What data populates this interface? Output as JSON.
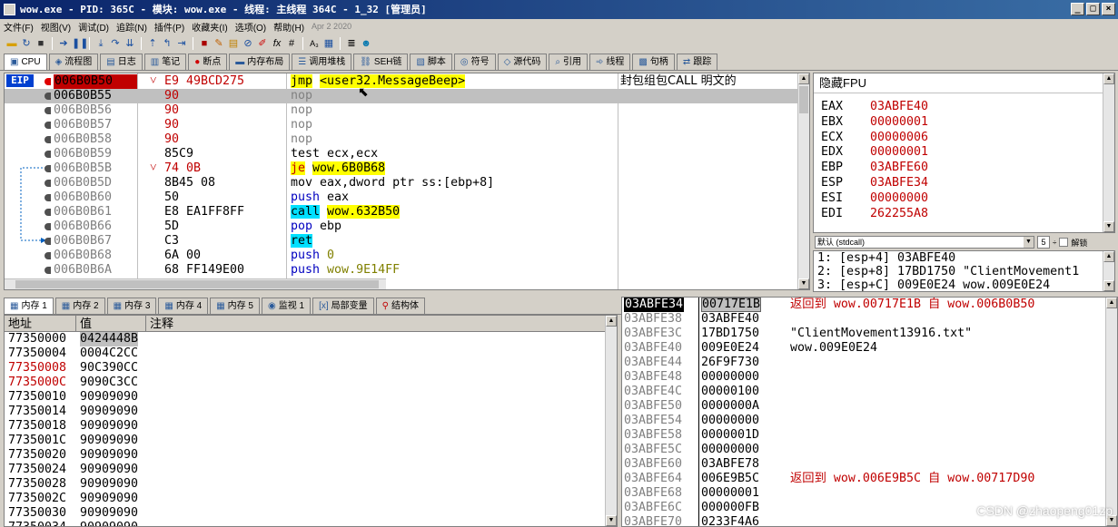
{
  "title": "wow.exe - PID: 365C - 模块: wow.exe - 线程: 主线程 364C - 1_32 [管理员]",
  "window_buttons": [
    "_",
    "□",
    "×"
  ],
  "menu": [
    "文件(F)",
    "视图(V)",
    "调试(D)",
    "追踪(N)",
    "插件(P)",
    "收藏夹(I)",
    "选项(O)",
    "帮助(H)"
  ],
  "menu_date": "Apr 2 2020",
  "toolbar_icons": [
    "folder-icon",
    "restart-icon",
    "close-icon",
    "run-icon",
    "pause-icon",
    "step-into-icon",
    "step-over-icon",
    "trace-into-icon",
    "trace-over-icon",
    "execute-till-return-icon",
    "run-to-user-icon",
    "stop-icon",
    "patch-icon",
    "highlight-icon",
    "link-icon",
    "comment-icon",
    "fx-icon",
    "hash-icon",
    "font-icon",
    "calc-icon",
    "list-icon",
    "help-icon"
  ],
  "tabs": [
    {
      "label": "CPU",
      "icon": "cpu-icon"
    },
    {
      "label": "流程图",
      "icon": "graph-icon"
    },
    {
      "label": "日志",
      "icon": "log-icon"
    },
    {
      "label": "笔记",
      "icon": "notes-icon"
    },
    {
      "label": "断点",
      "icon": "breakpoint-icon"
    },
    {
      "label": "内存布局",
      "icon": "memory-map-icon"
    },
    {
      "label": "调用堆栈",
      "icon": "callstack-icon"
    },
    {
      "label": "SEH链",
      "icon": "seh-icon"
    },
    {
      "label": "脚本",
      "icon": "script-icon"
    },
    {
      "label": "符号",
      "icon": "symbol-icon"
    },
    {
      "label": "源代码",
      "icon": "source-icon"
    },
    {
      "label": "引用",
      "icon": "reference-icon"
    },
    {
      "label": "线程",
      "icon": "thread-icon"
    },
    {
      "label": "句柄",
      "icon": "handle-icon"
    },
    {
      "label": "跟踪",
      "icon": "trace-icon"
    }
  ],
  "eip_label": "EIP",
  "disasm": [
    {
      "addr": "006B0B50",
      "bytes": "E9 49BCD275",
      "arrow": "˅",
      "mn": "jmp",
      "op": "<user32.MessageBeep>",
      "comment": "封包组包CALL 明文的"
    },
    {
      "addr": "006B0B55",
      "bytes": "90",
      "arrow": "",
      "mn": "nop",
      "op": "",
      "comment": ""
    },
    {
      "addr": "006B0B56",
      "bytes": "90",
      "arrow": "",
      "mn": "nop",
      "op": "",
      "comment": ""
    },
    {
      "addr": "006B0B57",
      "bytes": "90",
      "arrow": "",
      "mn": "nop",
      "op": "",
      "comment": ""
    },
    {
      "addr": "006B0B58",
      "bytes": "90",
      "arrow": "",
      "mn": "nop",
      "op": "",
      "comment": ""
    },
    {
      "addr": "006B0B59",
      "bytes": "85C9",
      "arrow": "",
      "mn": "test",
      "op": "ecx,ecx",
      "comment": ""
    },
    {
      "addr": "006B0B5B",
      "bytes": "74 0B",
      "arrow": "˅",
      "mn": "je",
      "op": "wow.6B0B68",
      "comment": ""
    },
    {
      "addr": "006B0B5D",
      "bytes": "8B45 08",
      "arrow": "",
      "mn": "mov",
      "op": "eax,dword ptr ss:[ebp+8]",
      "comment": ""
    },
    {
      "addr": "006B0B60",
      "bytes": "50",
      "arrow": "",
      "mn": "push",
      "op": "eax",
      "comment": ""
    },
    {
      "addr": "006B0B61",
      "bytes": "E8 EA1FF8FF",
      "arrow": "",
      "mn": "call",
      "op": "wow.632B50",
      "comment": ""
    },
    {
      "addr": "006B0B66",
      "bytes": "5D",
      "arrow": "",
      "mn": "pop",
      "op": "ebp",
      "comment": ""
    },
    {
      "addr": "006B0B67",
      "bytes": "C3",
      "arrow": "",
      "mn": "ret",
      "op": "",
      "comment": ""
    },
    {
      "addr": "006B0B68",
      "bytes": "6A 00",
      "arrow": "",
      "mn": "push",
      "op": "0",
      "comment": ""
    },
    {
      "addr": "006B0B6A",
      "bytes": "68 FF149E00",
      "arrow": "",
      "mn": "push",
      "op": "wow.9E14FF",
      "comment": ""
    }
  ],
  "fpu_header": "隐藏FPU",
  "registers": [
    {
      "name": "EAX",
      "value": "03ABFE40"
    },
    {
      "name": "EBX",
      "value": "00000001"
    },
    {
      "name": "ECX",
      "value": "00000006"
    },
    {
      "name": "EDX",
      "value": "00000001"
    },
    {
      "name": "EBP",
      "value": "03ABFE60"
    },
    {
      "name": "ESP",
      "value": "03ABFE34"
    },
    {
      "name": "ESI",
      "value": "00000000"
    },
    {
      "name": "EDI",
      "value": "262255A8"
    }
  ],
  "callconv": {
    "select": "默认 (stdcall)",
    "count": "5",
    "lock_label": "解锁"
  },
  "args": [
    "1: [esp+4] 03ABFE40",
    "2: [esp+8] 17BD1750 \"ClientMovement1",
    "3: [esp+C] 009E0E24 wow.009E0E24"
  ],
  "mem_tabs": [
    {
      "label": "内存 1",
      "icon": "dump-icon"
    },
    {
      "label": "内存 2",
      "icon": "dump-icon"
    },
    {
      "label": "内存 3",
      "icon": "dump-icon"
    },
    {
      "label": "内存 4",
      "icon": "dump-icon"
    },
    {
      "label": "内存 5",
      "icon": "dump-icon"
    },
    {
      "label": "监视 1",
      "icon": "watch-icon"
    },
    {
      "label": "局部变量",
      "icon": "locals-icon"
    },
    {
      "label": "结构体",
      "icon": "struct-icon"
    }
  ],
  "dump_headers": {
    "addr": "地址",
    "value": "值",
    "comment": "注释"
  },
  "dump": [
    {
      "addr": "77350000",
      "value": "0424448B",
      "red": false
    },
    {
      "addr": "77350004",
      "value": "0004C2CC",
      "red": false
    },
    {
      "addr": "77350008",
      "value": "90C390CC",
      "red": true
    },
    {
      "addr": "7735000C",
      "value": "9090C3CC",
      "red": true
    },
    {
      "addr": "77350010",
      "value": "90909090",
      "red": false
    },
    {
      "addr": "77350014",
      "value": "90909090",
      "red": false
    },
    {
      "addr": "77350018",
      "value": "90909090",
      "red": false
    },
    {
      "addr": "7735001C",
      "value": "90909090",
      "red": false
    },
    {
      "addr": "77350020",
      "value": "90909090",
      "red": false
    },
    {
      "addr": "77350024",
      "value": "90909090",
      "red": false
    },
    {
      "addr": "77350028",
      "value": "90909090",
      "red": false
    },
    {
      "addr": "7735002C",
      "value": "90909090",
      "red": false
    },
    {
      "addr": "77350030",
      "value": "90909090",
      "red": false
    },
    {
      "addr": "77350034",
      "value": "90909090",
      "red": false
    }
  ],
  "stack": [
    {
      "addr": "03ABFE34",
      "value": "00717E1B",
      "comment": "返回到 wow.00717E1B 自 wow.006B0B50",
      "red": true
    },
    {
      "addr": "03ABFE38",
      "value": "03ABFE40",
      "comment": "",
      "red": false
    },
    {
      "addr": "03ABFE3C",
      "value": "17BD1750",
      "comment": "\"ClientMovement13916.txt\"",
      "red": false
    },
    {
      "addr": "03ABFE40",
      "value": "009E0E24",
      "comment": "wow.009E0E24",
      "red": false
    },
    {
      "addr": "03ABFE44",
      "value": "26F9F730",
      "comment": "",
      "red": false
    },
    {
      "addr": "03ABFE48",
      "value": "00000000",
      "comment": "",
      "red": false
    },
    {
      "addr": "03ABFE4C",
      "value": "00000100",
      "comment": "",
      "red": false
    },
    {
      "addr": "03ABFE50",
      "value": "0000000A",
      "comment": "",
      "red": false
    },
    {
      "addr": "03ABFE54",
      "value": "00000000",
      "comment": "",
      "red": false
    },
    {
      "addr": "03ABFE58",
      "value": "0000001D",
      "comment": "",
      "red": false
    },
    {
      "addr": "03ABFE5C",
      "value": "00000000",
      "comment": "",
      "red": false
    },
    {
      "addr": "03ABFE60",
      "value": "03ABFE78",
      "comment": "",
      "red": false
    },
    {
      "addr": "03ABFE64",
      "value": "006E9B5C",
      "comment": "返回到 wow.006E9B5C 自 wow.00717D90",
      "red": true
    },
    {
      "addr": "03ABFE68",
      "value": "00000001",
      "comment": "",
      "red": false
    },
    {
      "addr": "03ABFE6C",
      "value": "000000FB",
      "comment": "",
      "red": false
    },
    {
      "addr": "03ABFE70",
      "value": "0233F4A6",
      "comment": "",
      "red": false
    }
  ],
  "watermark": "CSDN @zhaopeng01zp"
}
